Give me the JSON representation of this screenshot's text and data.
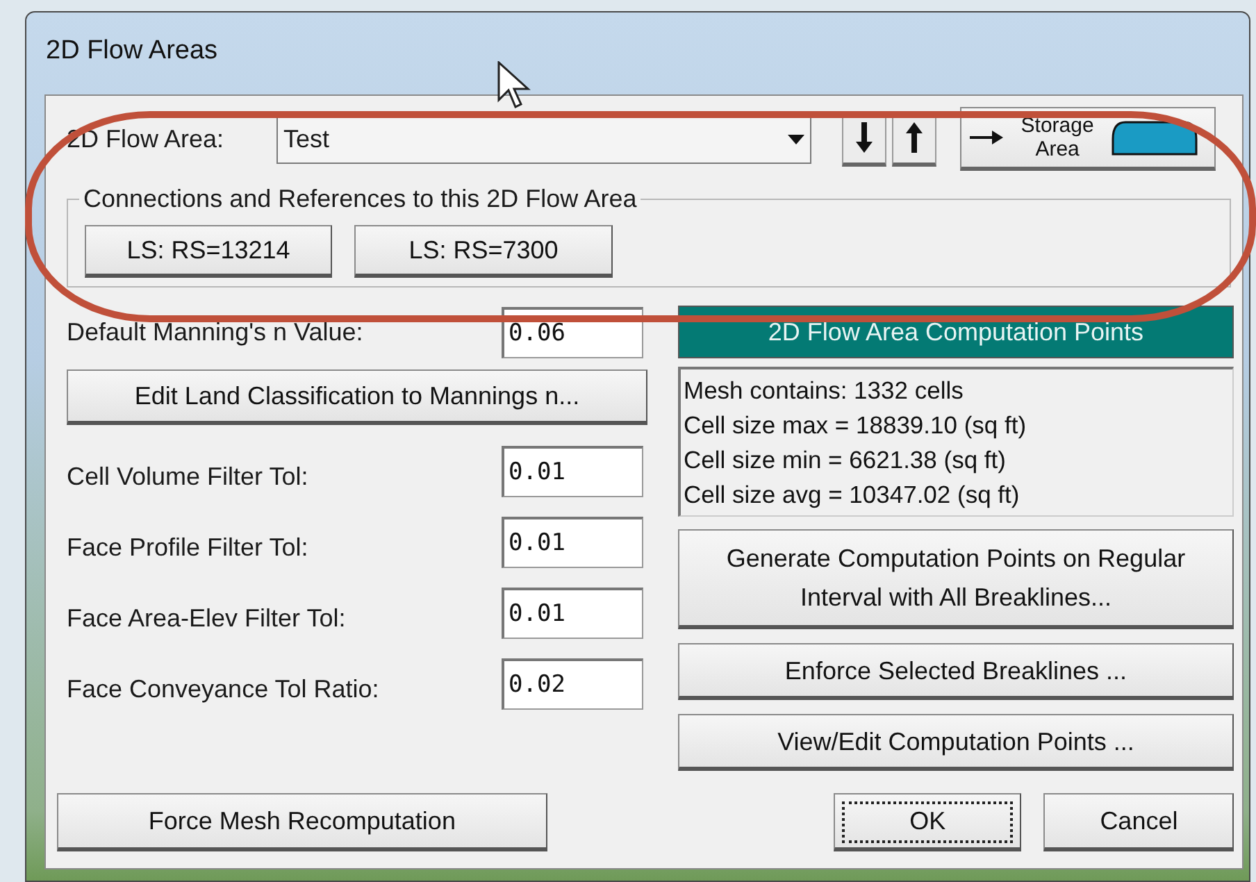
{
  "window": {
    "title": "2D Flow Areas"
  },
  "area_selector": {
    "label": "2D Flow Area:",
    "value": "Test"
  },
  "storage_button": {
    "label": "Storage Area"
  },
  "connections": {
    "legend": "Connections and References to this 2D Flow Area",
    "buttons": [
      "LS: RS=13214",
      "LS: RS=7300"
    ]
  },
  "manning": {
    "label": "Default Manning's n Value:",
    "value": "0.06"
  },
  "edit_land_button": "Edit Land Classification to Mannings n...",
  "tolerances": [
    {
      "label": "Cell Volume Filter Tol:",
      "value": "0.01"
    },
    {
      "label": "Face Profile Filter Tol:",
      "value": "0.01"
    },
    {
      "label": "Face Area-Elev Filter Tol:",
      "value": "0.01"
    },
    {
      "label": "Face Conveyance Tol Ratio:",
      "value": "0.02"
    }
  ],
  "computation_points": {
    "header": "2D Flow Area Computation Points",
    "info": [
      "Mesh contains: 1332 cells",
      "Cell size max = 18839.10 (sq ft)",
      "Cell size min = 6621.38 (sq ft)",
      "Cell size avg = 10347.02 (sq ft)"
    ],
    "buttons": [
      "Generate Computation Points on Regular Interval with All Breaklines...",
      "Enforce Selected Breaklines ...",
      "View/Edit Computation Points ..."
    ]
  },
  "footer": {
    "force_button": "Force Mesh Recomputation",
    "buttons": [
      {
        "label": "OK",
        "focused": true
      },
      {
        "label": "Cancel",
        "focused": false
      }
    ]
  },
  "annotation": {
    "kind": "oval"
  }
}
